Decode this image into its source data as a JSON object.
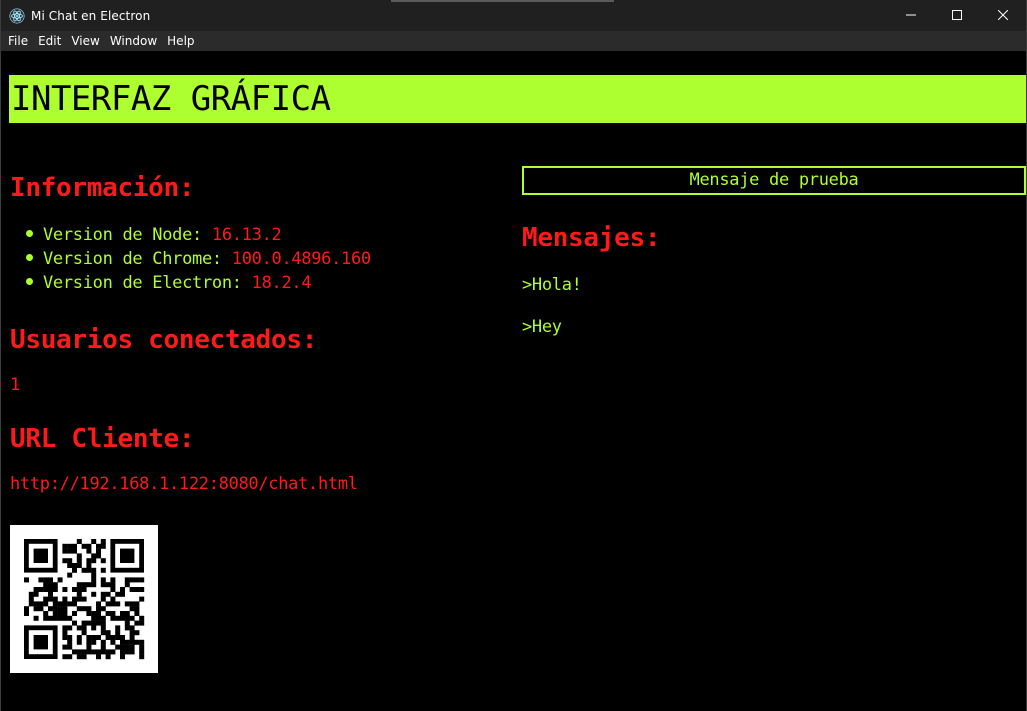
{
  "window": {
    "title": "Mi Chat en Electron"
  },
  "menu": [
    "File",
    "Edit",
    "View",
    "Window",
    "Help"
  ],
  "banner": "INTERFAZ GRÁFICA",
  "info": {
    "heading": "Información:",
    "items": [
      {
        "label": "Version de Node:",
        "value": "16.13.2"
      },
      {
        "label": "Version de Chrome:",
        "value": "100.0.4896.160"
      },
      {
        "label": "Version de Electron:",
        "value": "18.2.4"
      }
    ]
  },
  "users": {
    "heading": "Usuarios conectados:",
    "count": "1"
  },
  "client": {
    "heading": "URL Cliente:",
    "url": "http://192.168.1.122:8080/chat.html"
  },
  "messages": {
    "input_value": "Mensaje de prueba",
    "heading": "Mensajes:",
    "items": [
      ">Hola!",
      ">Hey"
    ]
  },
  "colors": {
    "accent_green": "#adff2f",
    "accent_red": "#ff1a1a",
    "background": "#000000"
  },
  "icons": {
    "app": "electron-icon",
    "minimize": "minimize-icon",
    "maximize": "maximize-icon",
    "close": "close-icon"
  }
}
